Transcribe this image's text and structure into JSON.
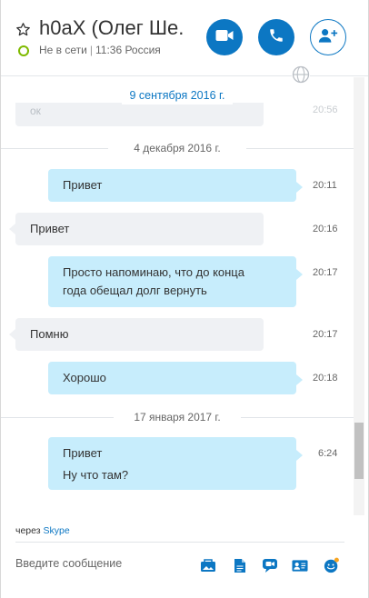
{
  "header": {
    "contact_name": "h0aX (Олег Ше...",
    "status": "Не в сети",
    "status_separator": "|",
    "local_time": "11:36 Россия"
  },
  "chat": {
    "top_date": "9 сентября 2016 г.",
    "ghost_text": "ок",
    "ghost_time": "20:56",
    "date_2": "4 декабря 2016 г.",
    "date_3": "17 января 2017 г.",
    "messages": [
      {
        "direction": "out",
        "lines": [
          "Привет"
        ],
        "time": "20:11"
      },
      {
        "direction": "in",
        "lines": [
          "Привет"
        ],
        "time": "20:16"
      },
      {
        "direction": "out",
        "lines": [
          "Просто напоминаю, что до конца",
          "года обещал долг вернуть"
        ],
        "time": "20:17"
      },
      {
        "direction": "in",
        "lines": [
          "Помню"
        ],
        "time": "20:17"
      },
      {
        "direction": "out",
        "lines": [
          "Хорошо"
        ],
        "time": "20:18"
      },
      {
        "direction": "out",
        "lines": [
          "Привет",
          "Ну что там?"
        ],
        "time": "6:24"
      }
    ]
  },
  "footer": {
    "via_prefix": "через",
    "via_service": "Skype",
    "compose_placeholder": "Введите сообщение"
  },
  "icons": [
    "star-icon",
    "video-call-icon",
    "phone-icon",
    "add-person-icon",
    "globe-icon",
    "image-send-icon",
    "file-icon",
    "video-message-icon",
    "contact-card-icon",
    "emoji-icon"
  ],
  "colors": {
    "accent": "#0c77c3",
    "outgoing_bubble": "#c7edfc",
    "incoming_bubble": "#eff1f4",
    "status_offline_ring": "#7fba00"
  }
}
